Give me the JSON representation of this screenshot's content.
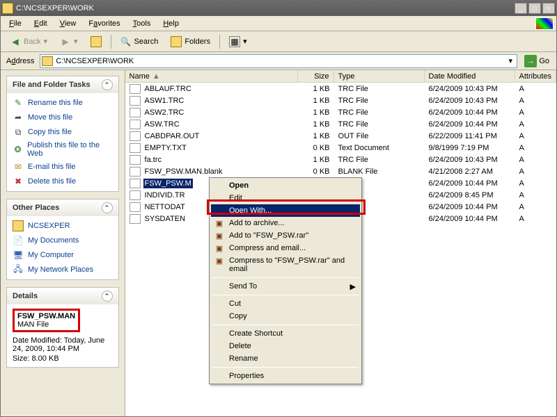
{
  "window": {
    "title": "C:\\NCSEXPER\\WORK"
  },
  "menus": {
    "file": "File",
    "edit": "Edit",
    "view": "View",
    "favorites": "Favorites",
    "tools": "Tools",
    "help": "Help"
  },
  "toolbar": {
    "back": "Back",
    "search": "Search",
    "folders": "Folders"
  },
  "address": {
    "label": "Address",
    "value": "C:\\NCSEXPER\\WORK",
    "go": "Go"
  },
  "tasks": {
    "header": "File and Folder Tasks",
    "rename": "Rename this file",
    "move": "Move this file",
    "copy": "Copy this file",
    "publish": "Publish this file to the Web",
    "email": "E-mail this file",
    "delete": "Delete this file"
  },
  "places": {
    "header": "Other Places",
    "items": [
      "NCSEXPER",
      "My Documents",
      "My Computer",
      "My Network Places"
    ]
  },
  "details": {
    "header": "Details",
    "filename": "FSW_PSW.MAN",
    "filetype": "MAN File",
    "date_label": "Date Modified: Today, June 24, 2009, 10:44 PM",
    "size_label": "Size: 8.00 KB"
  },
  "columns": {
    "name": "Name",
    "size": "Size",
    "type": "Type",
    "date": "Date Modified",
    "attr": "Attributes"
  },
  "rows": [
    {
      "name": "ABLAUF.TRC",
      "size": "1 KB",
      "type": "TRC File",
      "date": "6/24/2009 10:43 PM",
      "attr": "A",
      "ico": "trc"
    },
    {
      "name": "ASW1.TRC",
      "size": "1 KB",
      "type": "TRC File",
      "date": "6/24/2009 10:43 PM",
      "attr": "A",
      "ico": "trc"
    },
    {
      "name": "ASW2.TRC",
      "size": "1 KB",
      "type": "TRC File",
      "date": "6/24/2009 10:44 PM",
      "attr": "A",
      "ico": "trc"
    },
    {
      "name": "ASW.TRC",
      "size": "1 KB",
      "type": "TRC File",
      "date": "6/24/2009 10:44 PM",
      "attr": "A",
      "ico": "trc"
    },
    {
      "name": "CABDPAR.OUT",
      "size": "1 KB",
      "type": "OUT File",
      "date": "6/22/2009 11:41 PM",
      "attr": "A",
      "ico": "out"
    },
    {
      "name": "EMPTY.TXT",
      "size": "0 KB",
      "type": "Text Document",
      "date": "9/8/1999 7:19 PM",
      "attr": "A",
      "ico": "txt"
    },
    {
      "name": "fa.trc",
      "size": "1 KB",
      "type": "TRC File",
      "date": "6/24/2009 10:43 PM",
      "attr": "A",
      "ico": "trc"
    },
    {
      "name": "FSW_PSW.MAN.blank",
      "size": "0 KB",
      "type": "BLANK File",
      "date": "4/21/2008 2:27 AM",
      "attr": "A",
      "ico": "man"
    },
    {
      "name": "FSW_PSW.MAN",
      "size": "",
      "type": "File",
      "date": "6/24/2009 10:44 PM",
      "attr": "A",
      "ico": "man",
      "selected": true,
      "truncated": "FSW_PSW.M"
    },
    {
      "name": "INDIVID.TR",
      "size": "",
      "type": "File",
      "date": "6/24/2009 8:45 PM",
      "attr": "A",
      "ico": "trc"
    },
    {
      "name": "NETTODAT",
      "size": "",
      "type": "File",
      "date": "6/24/2009 10:44 PM",
      "attr": "A",
      "ico": "trc"
    },
    {
      "name": "SYSDATEN",
      "size": "",
      "type": "File",
      "date": "6/24/2009 10:44 PM",
      "attr": "A",
      "ico": "trc"
    }
  ],
  "ctx": {
    "open": "Open",
    "edit": "Edit",
    "openwith": "Open With...",
    "addarchive": "Add to archive...",
    "addrar": "Add to \"FSW_PSW.rar\"",
    "compress": "Compress and email...",
    "compressrar": "Compress to \"FSW_PSW.rar\" and email",
    "sendto": "Send To",
    "cut": "Cut",
    "copy": "Copy",
    "shortcut": "Create Shortcut",
    "delete": "Delete",
    "rename": "Rename",
    "properties": "Properties"
  }
}
